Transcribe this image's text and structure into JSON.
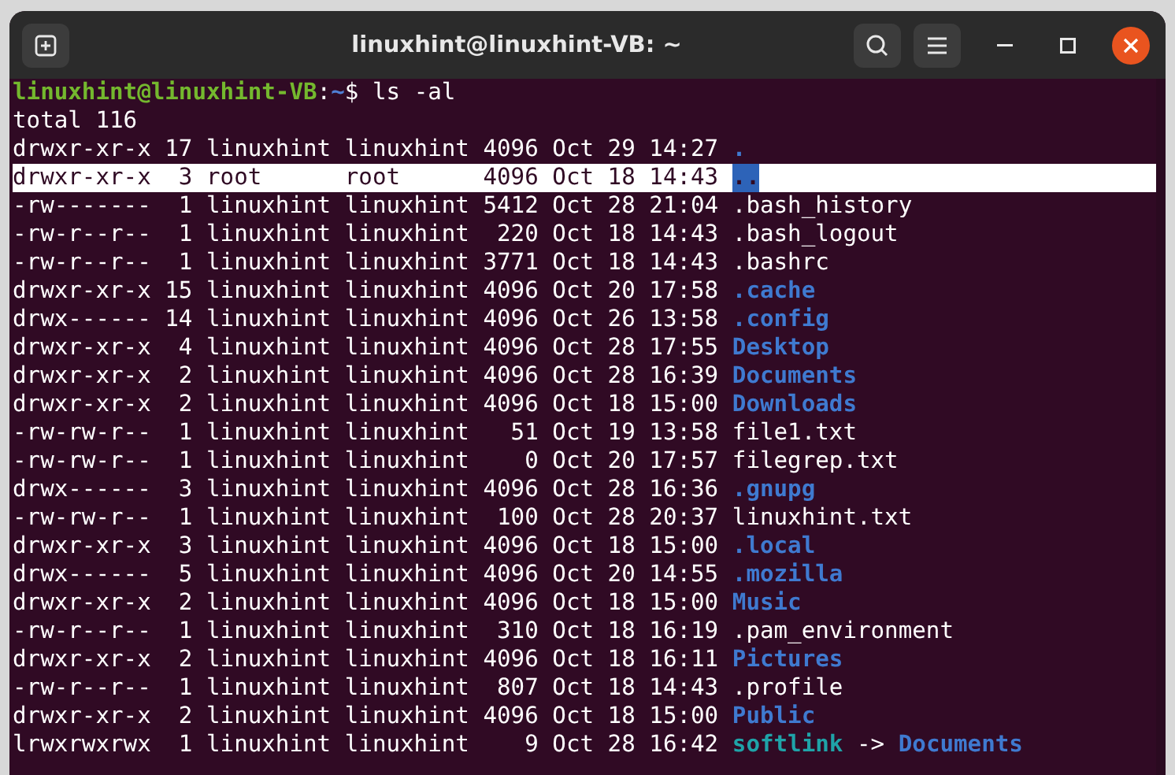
{
  "window": {
    "title": "linuxhint@linuxhint-VB: ~"
  },
  "prompt": {
    "user_host": "linuxhint@linuxhint-VB",
    "separator": ":",
    "path": "~",
    "symbol": "$",
    "command": "ls -al"
  },
  "summary": "total 116",
  "listing": [
    {
      "info": "drwxr-xr-x 17 linuxhint linuxhint 4096 Oct 29 14:27",
      "name": ".",
      "kind": "dir",
      "selected": false
    },
    {
      "info": "drwxr-xr-x  3 root      root      4096 Oct 18 14:43",
      "name": "..",
      "kind": "dir",
      "selected": true
    },
    {
      "info": "-rw-------  1 linuxhint linuxhint 5412 Oct 28 21:04",
      "name": ".bash_history",
      "kind": "file",
      "selected": false
    },
    {
      "info": "-rw-r--r--  1 linuxhint linuxhint  220 Oct 18 14:43",
      "name": ".bash_logout",
      "kind": "file",
      "selected": false
    },
    {
      "info": "-rw-r--r--  1 linuxhint linuxhint 3771 Oct 18 14:43",
      "name": ".bashrc",
      "kind": "file",
      "selected": false
    },
    {
      "info": "drwxr-xr-x 15 linuxhint linuxhint 4096 Oct 20 17:58",
      "name": ".cache",
      "kind": "dir",
      "selected": false
    },
    {
      "info": "drwx------ 14 linuxhint linuxhint 4096 Oct 26 13:58",
      "name": ".config",
      "kind": "dir",
      "selected": false
    },
    {
      "info": "drwxr-xr-x  4 linuxhint linuxhint 4096 Oct 28 17:55",
      "name": "Desktop",
      "kind": "dir",
      "selected": false
    },
    {
      "info": "drwxr-xr-x  2 linuxhint linuxhint 4096 Oct 28 16:39",
      "name": "Documents",
      "kind": "dir",
      "selected": false
    },
    {
      "info": "drwxr-xr-x  2 linuxhint linuxhint 4096 Oct 18 15:00",
      "name": "Downloads",
      "kind": "dir",
      "selected": false
    },
    {
      "info": "-rw-rw-r--  1 linuxhint linuxhint   51 Oct 19 13:58",
      "name": "file1.txt",
      "kind": "file",
      "selected": false
    },
    {
      "info": "-rw-rw-r--  1 linuxhint linuxhint    0 Oct 20 17:57",
      "name": "filegrep.txt",
      "kind": "file",
      "selected": false
    },
    {
      "info": "drwx------  3 linuxhint linuxhint 4096 Oct 28 16:36",
      "name": ".gnupg",
      "kind": "dir",
      "selected": false
    },
    {
      "info": "-rw-rw-r--  1 linuxhint linuxhint  100 Oct 28 20:37",
      "name": "linuxhint.txt",
      "kind": "file",
      "selected": false
    },
    {
      "info": "drwxr-xr-x  3 linuxhint linuxhint 4096 Oct 18 15:00",
      "name": ".local",
      "kind": "dir",
      "selected": false
    },
    {
      "info": "drwx------  5 linuxhint linuxhint 4096 Oct 20 14:55",
      "name": ".mozilla",
      "kind": "dir",
      "selected": false
    },
    {
      "info": "drwxr-xr-x  2 linuxhint linuxhint 4096 Oct 18 15:00",
      "name": "Music",
      "kind": "dir",
      "selected": false
    },
    {
      "info": "-rw-r--r--  1 linuxhint linuxhint  310 Oct 18 16:19",
      "name": ".pam_environment",
      "kind": "file",
      "selected": false
    },
    {
      "info": "drwxr-xr-x  2 linuxhint linuxhint 4096 Oct 18 16:11",
      "name": "Pictures",
      "kind": "dir",
      "selected": false
    },
    {
      "info": "-rw-r--r--  1 linuxhint linuxhint  807 Oct 18 14:43",
      "name": ".profile",
      "kind": "file",
      "selected": false
    },
    {
      "info": "drwxr-xr-x  2 linuxhint linuxhint 4096 Oct 18 15:00",
      "name": "Public",
      "kind": "dir",
      "selected": false
    },
    {
      "info": "lrwxrwxrwx  1 linuxhint linuxhint    9 Oct 28 16:42",
      "name": "softlink",
      "kind": "link",
      "arrow": "->",
      "target": "Documents",
      "selected": false
    }
  ]
}
